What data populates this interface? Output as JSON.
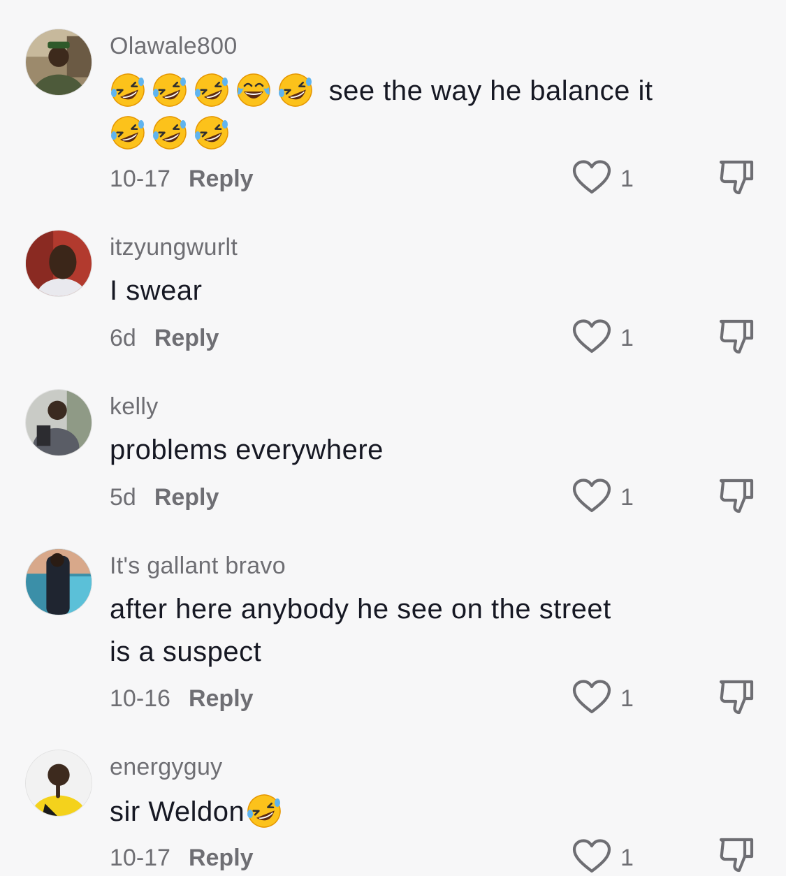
{
  "comments": [
    {
      "username": "Olawale800",
      "text_line1": "see the way he balance it",
      "emoji_line1": [
        "rofl-emoji",
        "rofl-emoji",
        "rofl-emoji",
        "joy-emoji",
        "rofl-emoji"
      ],
      "emoji_line2": [
        "rofl-emoji",
        "rofl-emoji",
        "rofl-emoji"
      ],
      "date": "10-17",
      "reply_label": "Reply",
      "likes": "1"
    },
    {
      "username": "itzyungwurlt",
      "text": "I swear",
      "date": "6d",
      "reply_label": "Reply",
      "likes": "1"
    },
    {
      "username": "kelly",
      "text": "problems everywhere",
      "date": "5d",
      "reply_label": "Reply",
      "likes": "1"
    },
    {
      "username": "It's gallant bravo",
      "text_line1": "after here anybody he see on the street",
      "text_line2": "is a suspect",
      "date": "10-16",
      "reply_label": "Reply",
      "likes": "1"
    },
    {
      "username": "energyguy",
      "text": "sir Weldon",
      "emoji_after": [
        "rofl-emoji"
      ],
      "date": "10-17",
      "reply_label": "Reply",
      "likes": "1"
    }
  ],
  "icons": {
    "like": "heart-outline-icon",
    "dislike": "thumbs-down-outline-icon"
  },
  "colors": {
    "background": "#f7f7f8",
    "text": "#161823",
    "secondary": "#6e6e73"
  }
}
